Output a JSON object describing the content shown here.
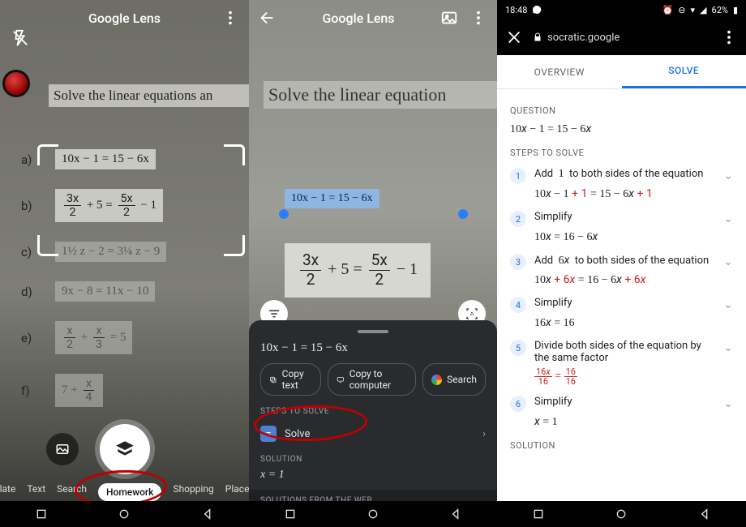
{
  "panel1": {
    "title": "Google Lens",
    "headline": "Solve the linear equations an",
    "items": [
      {
        "label": "a)",
        "eq": "10x − 1 = 15 − 6x",
        "muted": false
      },
      {
        "label": "b)",
        "eq_html": "frac1",
        "muted": false
      },
      {
        "label": "c)",
        "eq": "1½ z − 2 = 3¼ z − 9",
        "muted": true
      },
      {
        "label": "d)",
        "eq": "9x − 8 = 11x − 10",
        "muted": true
      },
      {
        "label": "e)",
        "eq_html": "frac2",
        "muted": true
      },
      {
        "label": "f)",
        "eq_html": "frac3",
        "muted": true
      }
    ],
    "modes": [
      "slate",
      "Text",
      "Search",
      "Homework",
      "Shopping",
      "Places"
    ],
    "active_mode": "Homework"
  },
  "panel2": {
    "title": "Google Lens",
    "headline": "Solve the linear equation",
    "selected_eq": "10x − 1 = 15 − 6x",
    "sheet": {
      "selected_text": "10x − 1 = 15 − 6x",
      "chips": [
        "Copy text",
        "Copy to computer",
        "Search"
      ],
      "steps_label": "STEPS TO SOLVE",
      "solve": "Solve",
      "solution_label": "SOLUTION",
      "solution": "x = 1",
      "web_label": "SOLUTIONS FROM THE WEB"
    }
  },
  "panel3": {
    "status": {
      "time": "18:48",
      "battery": "62%"
    },
    "url": "socratic.google",
    "tabs": [
      "OVERVIEW",
      "SOLVE"
    ],
    "active_tab": "SOLVE",
    "question_label": "QUESTION",
    "question": "10x − 1 = 15 − 6x",
    "steps_label": "STEPS TO SOLVE",
    "steps": [
      {
        "n": "1",
        "text_pre": "Add ",
        "k": "1",
        "text_post": " to both sides of the equation",
        "eq": "10x − 1 + 1 = 15 − 6x + 1",
        "hl": [
          "+ 1",
          "+ 1"
        ]
      },
      {
        "n": "2",
        "text": "Simplify",
        "eq": "10x = 16 − 6x"
      },
      {
        "n": "3",
        "text_pre": "Add ",
        "k": "6x",
        "text_post": " to both sides of the equation",
        "eq": "10x + 6x = 16 − 6x + 6x",
        "hl": [
          "+ 6x",
          "+ 6x"
        ]
      },
      {
        "n": "4",
        "text": "Simplify",
        "eq": "16x = 16"
      },
      {
        "n": "5",
        "text": "Divide both sides of the equation by the same factor",
        "eq_frac": true
      },
      {
        "n": "6",
        "text": "Simplify",
        "eq": "x = 1"
      }
    ],
    "solution_label": "SOLUTION"
  }
}
